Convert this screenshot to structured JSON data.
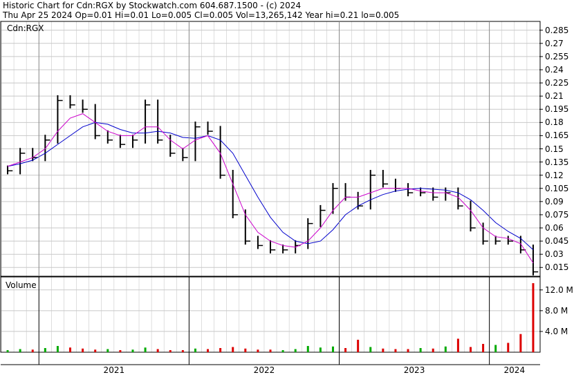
{
  "header": {
    "line1": "Historic Chart for Cdn:RGX by Stockwatch.com 604.687.1500 - (c) 2024",
    "line2": "Thu Apr 25 2024   Op=0.01  Hi=0.01  Lo=0.005   Cl=0.005   Vol=13,265,142   Year hi=0.21  lo=0.005"
  },
  "price_panel": {
    "label": "Cdn:RGX"
  },
  "volume_panel": {
    "label": "Volume"
  },
  "colors": {
    "bars": "#000000",
    "ma_short": "#cc00cc",
    "ma_long": "#0000cc",
    "vol_up": "#00aa00",
    "vol_down": "#dd0000",
    "grid": "#c8c8c8"
  },
  "chart_data": [
    {
      "type": "line",
      "title": "Historic Chart for Cdn:RGX",
      "series_label": "Cdn:RGX",
      "y_ticks": [
        "0.285",
        "0.27",
        "0.255",
        "0.24",
        "0.225",
        "0.21",
        "0.195",
        "0.18",
        "0.165",
        "0.15",
        "0.135",
        "0.12",
        "0.105",
        "0.09",
        "0.075",
        "0.06",
        "0.045",
        "0.03",
        "0.015"
      ],
      "ylim": [
        0.005,
        0.295
      ],
      "x_ticks": [
        "2021",
        "2022",
        "2023",
        "2024"
      ],
      "grid": true,
      "price_series": {
        "x": [
          "2020-10",
          "2020-11",
          "2020-12",
          "2021-01",
          "2021-02",
          "2021-03",
          "2021-04",
          "2021-05",
          "2021-06",
          "2021-07",
          "2021-08",
          "2021-09",
          "2021-10",
          "2021-11",
          "2021-12",
          "2022-01",
          "2022-02",
          "2022-03",
          "2022-04",
          "2022-05",
          "2022-06",
          "2022-07",
          "2022-08",
          "2022-09",
          "2022-10",
          "2022-11",
          "2022-12",
          "2023-01",
          "2023-02",
          "2023-03",
          "2023-04",
          "2023-05",
          "2023-06",
          "2023-07",
          "2023-08",
          "2023-09",
          "2023-10",
          "2023-11",
          "2023-12",
          "2024-01",
          "2024-02",
          "2024-03",
          "2024-04"
        ],
        "close": [
          0.125,
          0.145,
          0.14,
          0.16,
          0.205,
          0.2,
          0.195,
          0.165,
          0.16,
          0.155,
          0.16,
          0.2,
          0.16,
          0.145,
          0.14,
          0.175,
          0.17,
          0.12,
          0.075,
          0.045,
          0.04,
          0.035,
          0.035,
          0.04,
          0.065,
          0.08,
          0.105,
          0.095,
          0.085,
          0.12,
          0.11,
          0.105,
          0.1,
          0.1,
          0.095,
          0.1,
          0.085,
          0.06,
          0.045,
          0.045,
          0.045,
          0.035,
          0.01
        ]
      },
      "moving_averages": [
        {
          "values": [
            0.13,
            0.135,
            0.14,
            0.15,
            0.17,
            0.185,
            0.19,
            0.18,
            0.17,
            0.165,
            0.165,
            0.175,
            0.175,
            0.16,
            0.15,
            0.16,
            0.165,
            0.145,
            0.11,
            0.075,
            0.055,
            0.045,
            0.04,
            0.038,
            0.045,
            0.06,
            0.08,
            0.095,
            0.095,
            0.1,
            0.105,
            0.105,
            0.105,
            0.102,
            0.1,
            0.1,
            0.095,
            0.08,
            0.06,
            0.05,
            0.048,
            0.042,
            0.02
          ]
        },
        {
          "values": [
            0.13,
            0.133,
            0.137,
            0.145,
            0.155,
            0.165,
            0.175,
            0.18,
            0.178,
            0.172,
            0.168,
            0.168,
            0.17,
            0.168,
            0.163,
            0.162,
            0.165,
            0.16,
            0.145,
            0.12,
            0.095,
            0.072,
            0.055,
            0.045,
            0.042,
            0.045,
            0.058,
            0.075,
            0.085,
            0.092,
            0.098,
            0.102,
            0.104,
            0.105,
            0.104,
            0.103,
            0.1,
            0.092,
            0.08,
            0.066,
            0.056,
            0.048,
            0.035
          ]
        }
      ]
    },
    {
      "type": "bar",
      "title": "Volume",
      "y_ticks": [
        "12.0 M",
        "8.0 M",
        "4.0 M"
      ],
      "ylim": [
        0,
        14.5
      ],
      "x": [
        "2020-10",
        "2020-11",
        "2020-12",
        "2021-01",
        "2021-02",
        "2021-03",
        "2021-04",
        "2021-05",
        "2021-06",
        "2021-07",
        "2021-08",
        "2021-09",
        "2021-10",
        "2021-11",
        "2021-12",
        "2022-01",
        "2022-02",
        "2022-03",
        "2022-04",
        "2022-05",
        "2022-06",
        "2022-07",
        "2022-08",
        "2022-09",
        "2022-10",
        "2022-11",
        "2022-12",
        "2023-01",
        "2023-02",
        "2023-03",
        "2023-04",
        "2023-05",
        "2023-06",
        "2023-07",
        "2023-08",
        "2023-09",
        "2023-10",
        "2023-11",
        "2023-12",
        "2024-01",
        "2024-02",
        "2024-03",
        "2024-04"
      ],
      "values": [
        0.4,
        0.6,
        0.5,
        0.8,
        1.2,
        0.9,
        0.7,
        0.5,
        0.6,
        0.4,
        0.5,
        0.9,
        0.6,
        0.4,
        0.4,
        0.7,
        0.6,
        0.8,
        1.0,
        0.7,
        0.5,
        0.5,
        0.4,
        0.6,
        1.2,
        0.9,
        1.1,
        0.8,
        2.4,
        1.0,
        0.7,
        0.6,
        0.6,
        0.8,
        0.7,
        1.1,
        2.6,
        1.0,
        1.6,
        1.4,
        1.8,
        3.5,
        13.3
      ],
      "direction": [
        "u",
        "u",
        "d",
        "u",
        "u",
        "d",
        "d",
        "d",
        "u",
        "d",
        "u",
        "u",
        "d",
        "d",
        "d",
        "u",
        "d",
        "d",
        "d",
        "d",
        "d",
        "d",
        "u",
        "u",
        "u",
        "u",
        "u",
        "d",
        "d",
        "u",
        "d",
        "d",
        "d",
        "u",
        "d",
        "u",
        "d",
        "d",
        "d",
        "u",
        "d",
        "d",
        "d"
      ]
    }
  ]
}
